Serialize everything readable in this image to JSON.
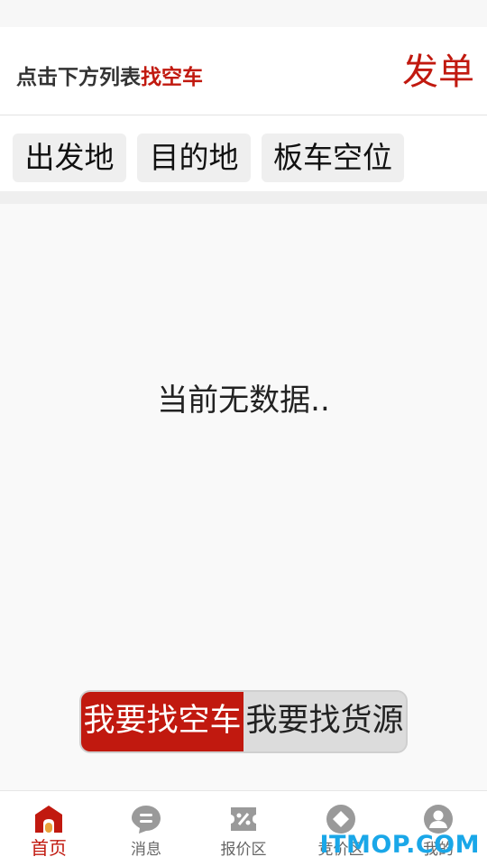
{
  "header": {
    "hint_prefix": "点击下方列表",
    "hint_accent": "找空车",
    "post_button": "发单"
  },
  "filters": [
    {
      "label": "出发地"
    },
    {
      "label": "目的地"
    },
    {
      "label": "板车空位"
    }
  ],
  "content": {
    "empty_message": "当前无数据.."
  },
  "mode_toggle": {
    "active_label": "我要找空车",
    "inactive_label": "我要找货源"
  },
  "tabbar": {
    "items": [
      {
        "label": "首页",
        "icon": "home-icon",
        "active": true
      },
      {
        "label": "消息",
        "icon": "message-icon",
        "active": false
      },
      {
        "label": "报价区",
        "icon": "quote-icon",
        "active": false
      },
      {
        "label": "竞价区",
        "icon": "bid-icon",
        "active": false
      },
      {
        "label": "我的",
        "icon": "profile-icon",
        "active": false
      }
    ]
  },
  "watermark": "ITMOP.COM",
  "colors": {
    "accent": "#c1190f",
    "icon_inactive": "#9a9a9a",
    "watermark": "#1aa7e8"
  }
}
